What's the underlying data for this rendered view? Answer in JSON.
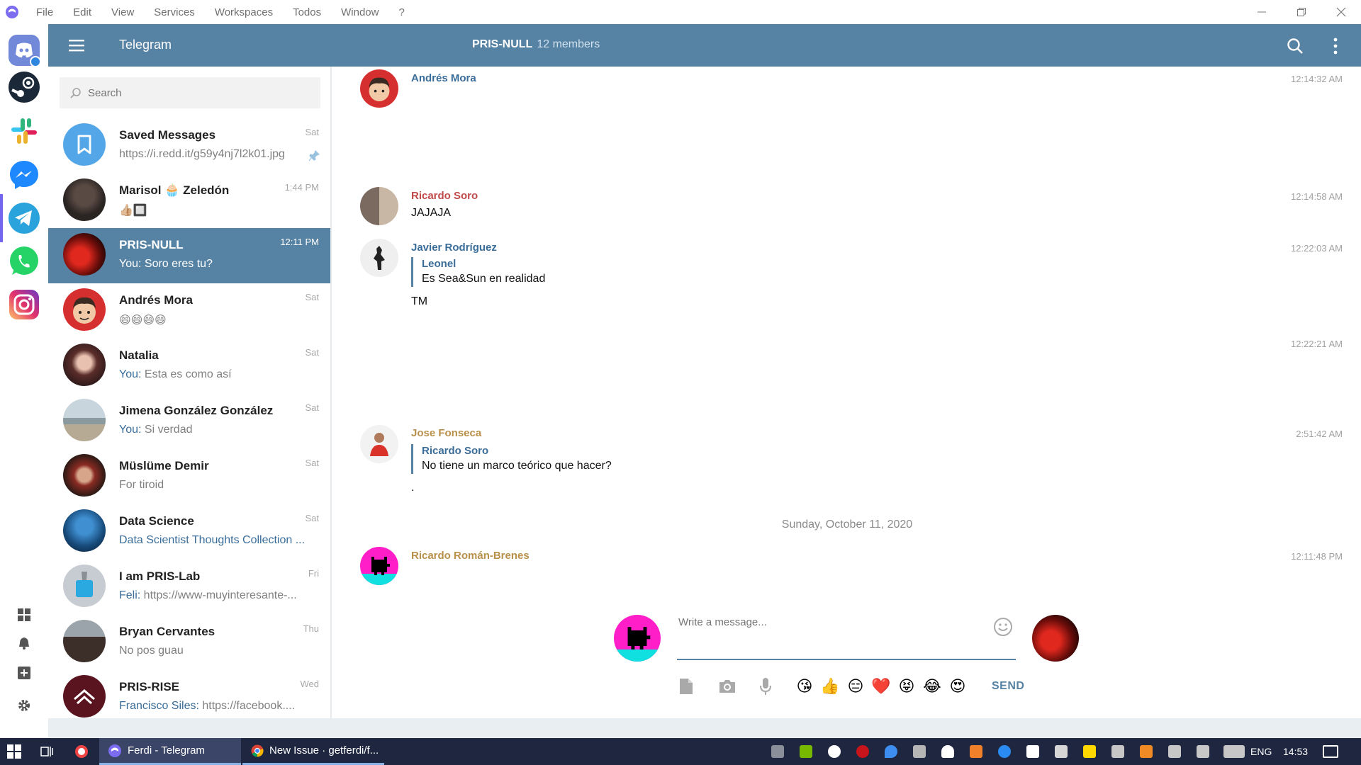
{
  "titlebar": {
    "menu": [
      "File",
      "Edit",
      "View",
      "Services",
      "Workspaces",
      "Todos",
      "Window",
      "?"
    ]
  },
  "services": [
    {
      "name": "discord",
      "icon": "discord-icon",
      "color": "#7289da",
      "has_badge": true
    },
    {
      "name": "steam",
      "icon": "steam-icon",
      "color": "#1b2838"
    },
    {
      "name": "slack",
      "icon": "slack-icon",
      "color": "#36c5f0"
    },
    {
      "name": "messenger",
      "icon": "messenger-icon",
      "color": "#1e88ff"
    },
    {
      "name": "telegram",
      "icon": "telegram-icon",
      "color": "#2aa3dc",
      "active": true
    },
    {
      "name": "whatsapp",
      "icon": "whatsapp-icon",
      "color": "#25d366"
    },
    {
      "name": "instagram",
      "icon": "instagram-icon",
      "color": "#e1306c"
    }
  ],
  "header": {
    "app_title": "Telegram",
    "chat_name": "PRIS-NULL",
    "chat_members": "12 members",
    "accent": "#5682a3"
  },
  "search": {
    "placeholder": "Search"
  },
  "chats": [
    {
      "name": "Saved Messages",
      "date": "Sat",
      "preview": "https://i.redd.it/g59y4nj7l2k01.jpg",
      "pinned": true
    },
    {
      "name": "Marisol 🧁 Zeledón",
      "date": "1:44 PM",
      "preview": "👍🏼🔲"
    },
    {
      "name": "PRIS-NULL",
      "date": "12:11 PM",
      "preview": "You: Soro eres tu?",
      "active": true
    },
    {
      "name": "Andrés Mora",
      "date": "Sat",
      "preview": "😄😄😄😄"
    },
    {
      "name": "Natalia",
      "date": "Sat",
      "sender": "You:",
      "preview": " Esta es como así"
    },
    {
      "name": "Jimena González González",
      "date": "Sat",
      "sender": "You:",
      "preview": " Si verdad"
    },
    {
      "name": "Müslüme Demir",
      "date": "Sat",
      "preview": "For tiroid"
    },
    {
      "name": "Data Science",
      "date": "Sat",
      "preview": "Data Scientist Thoughts Collection ...",
      "link": true
    },
    {
      "name": "I am PRIS-Lab",
      "date": "Fri",
      "sender": "Feli:",
      "preview": " https://www-muyinteresante-..."
    },
    {
      "name": "Bryan Cervantes",
      "date": "Thu",
      "preview": "No pos guau"
    },
    {
      "name": "PRIS-RISE",
      "date": "Wed",
      "sender": "Francisco Siles:",
      "preview": " https://facebook...."
    }
  ],
  "messages": [
    {
      "author": "Andrés Mora",
      "author_color": "#3a6d99",
      "time": "12:14:32 AM"
    },
    {
      "author": "Ricardo Soro",
      "author_color": "#c04a4a",
      "time": "12:14:58 AM",
      "text": "JAJAJA"
    },
    {
      "author": "Javier Rodríguez",
      "author_color": "#3a6d99",
      "time": "12:22:03 AM",
      "reply_author": "Leonel",
      "reply_text": "Es Sea&Sun en realidad",
      "text": "TM"
    },
    {
      "time": "12:22:21 AM"
    },
    {
      "author": "Jose Fonseca",
      "author_color": "#b8904a",
      "time": "2:51:42 AM",
      "reply_author": "Ricardo Soro",
      "reply_text": "No tiene un marco teórico que hacer?",
      "text": "."
    },
    {
      "author": "Ricardo Román-Brenes",
      "author_color": "#b8904a",
      "time": "12:11:48 PM"
    }
  ],
  "day_separator": "Sunday, October 11, 2020",
  "composer": {
    "placeholder": "Write a message...",
    "send_label": "SEND",
    "quick_emojis": [
      "😘",
      "👍",
      "😑",
      "❤️",
      "😝",
      "😂",
      "😍"
    ]
  },
  "taskbar": {
    "tasks": [
      "Ferdi - Telegram",
      "New Issue · getferdi/f..."
    ],
    "language": "ENG",
    "clock": "14:53"
  }
}
